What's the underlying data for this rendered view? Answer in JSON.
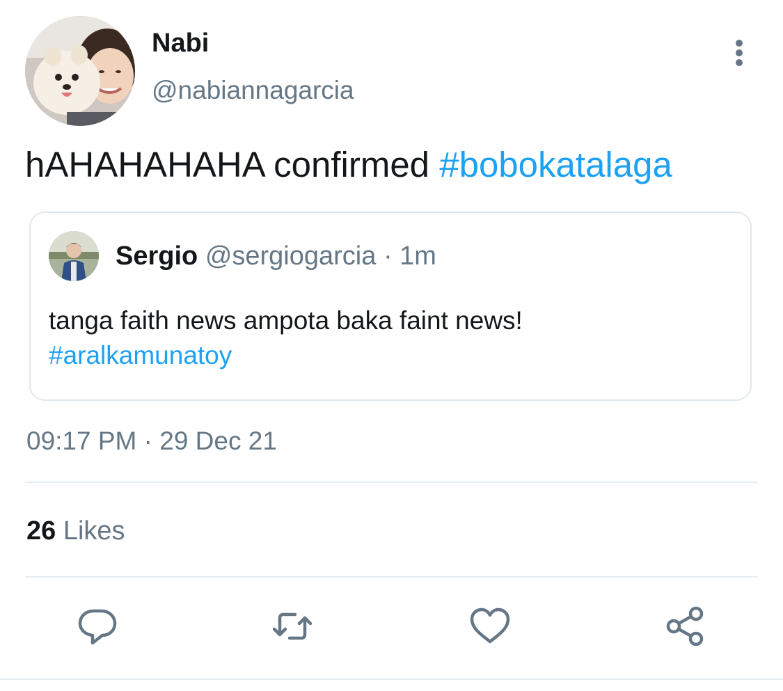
{
  "author": {
    "display_name": "Nabi",
    "handle": "@nabiannagarcia"
  },
  "tweet": {
    "text": "hAHAHAHAHA confirmed ",
    "hashtag": "#bobokatalaga",
    "timestamp": "09:17 PM · 29 Dec 21"
  },
  "quoted_tweet": {
    "display_name": "Sergio",
    "handle": "@sergiogarcia",
    "time": " · 1m",
    "text": "tanga faith news ampota baka faint news!",
    "hashtag": "#aralkamunatoy"
  },
  "stats": {
    "likes_count": "26",
    "likes_label": "Likes"
  },
  "icons": {
    "more": "more-vertical-icon",
    "reply": "reply-icon",
    "retweet": "retweet-icon",
    "like": "heart-icon",
    "share": "share-icon"
  },
  "colors": {
    "accent": "#1da1f2",
    "text_primary": "#14171a",
    "text_secondary": "#657786",
    "divider": "#e6ecf0"
  }
}
